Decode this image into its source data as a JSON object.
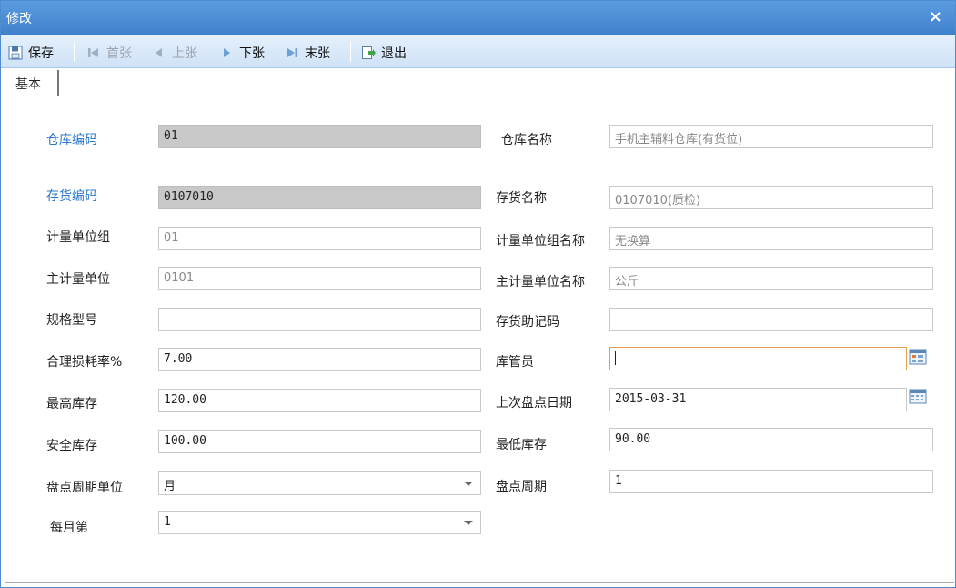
{
  "window": {
    "title": "修改",
    "close_label": "×"
  },
  "toolbar": {
    "save": "保存",
    "first": "首张",
    "prev": "上张",
    "next": "下张",
    "last": "末张",
    "exit": "退出"
  },
  "tabs": [
    {
      "label": "基本"
    }
  ],
  "form": {
    "warehouse_code": {
      "label": "仓库编码",
      "value": "01"
    },
    "warehouse_name": {
      "label": "仓库名称",
      "value": "手机主辅料仓库(有货位)"
    },
    "inventory_code": {
      "label": "存货编码",
      "value": "0107010"
    },
    "inventory_name": {
      "label": "存货名称",
      "value": "0107010(质检)"
    },
    "unit_group": {
      "label": "计量单位组",
      "value": "01"
    },
    "unit_group_name": {
      "label": "计量单位组名称",
      "value": "无换算"
    },
    "main_unit": {
      "label": "主计量单位",
      "value": "0101"
    },
    "main_unit_name": {
      "label": "主计量单位名称",
      "value": "公斤"
    },
    "spec_model": {
      "label": "规格型号",
      "value": ""
    },
    "mnemonic_code": {
      "label": "存货助记码",
      "value": ""
    },
    "loss_rate": {
      "label": "合理损耗率%",
      "value": "7.00"
    },
    "keeper": {
      "label": "库管员",
      "value": ""
    },
    "max_stock": {
      "label": "最高库存",
      "value": "120.00"
    },
    "last_check_date": {
      "label": "上次盘点日期",
      "value": "2015-03-31"
    },
    "safety_stock": {
      "label": "安全库存",
      "value": "100.00"
    },
    "min_stock": {
      "label": "最低库存",
      "value": "90.00"
    },
    "check_cycle_unit": {
      "label": "盘点周期单位",
      "value": "月"
    },
    "check_cycle": {
      "label": "盘点周期",
      "value": "1"
    },
    "monthly_day": {
      "label": "每月第",
      "value": "1"
    }
  }
}
